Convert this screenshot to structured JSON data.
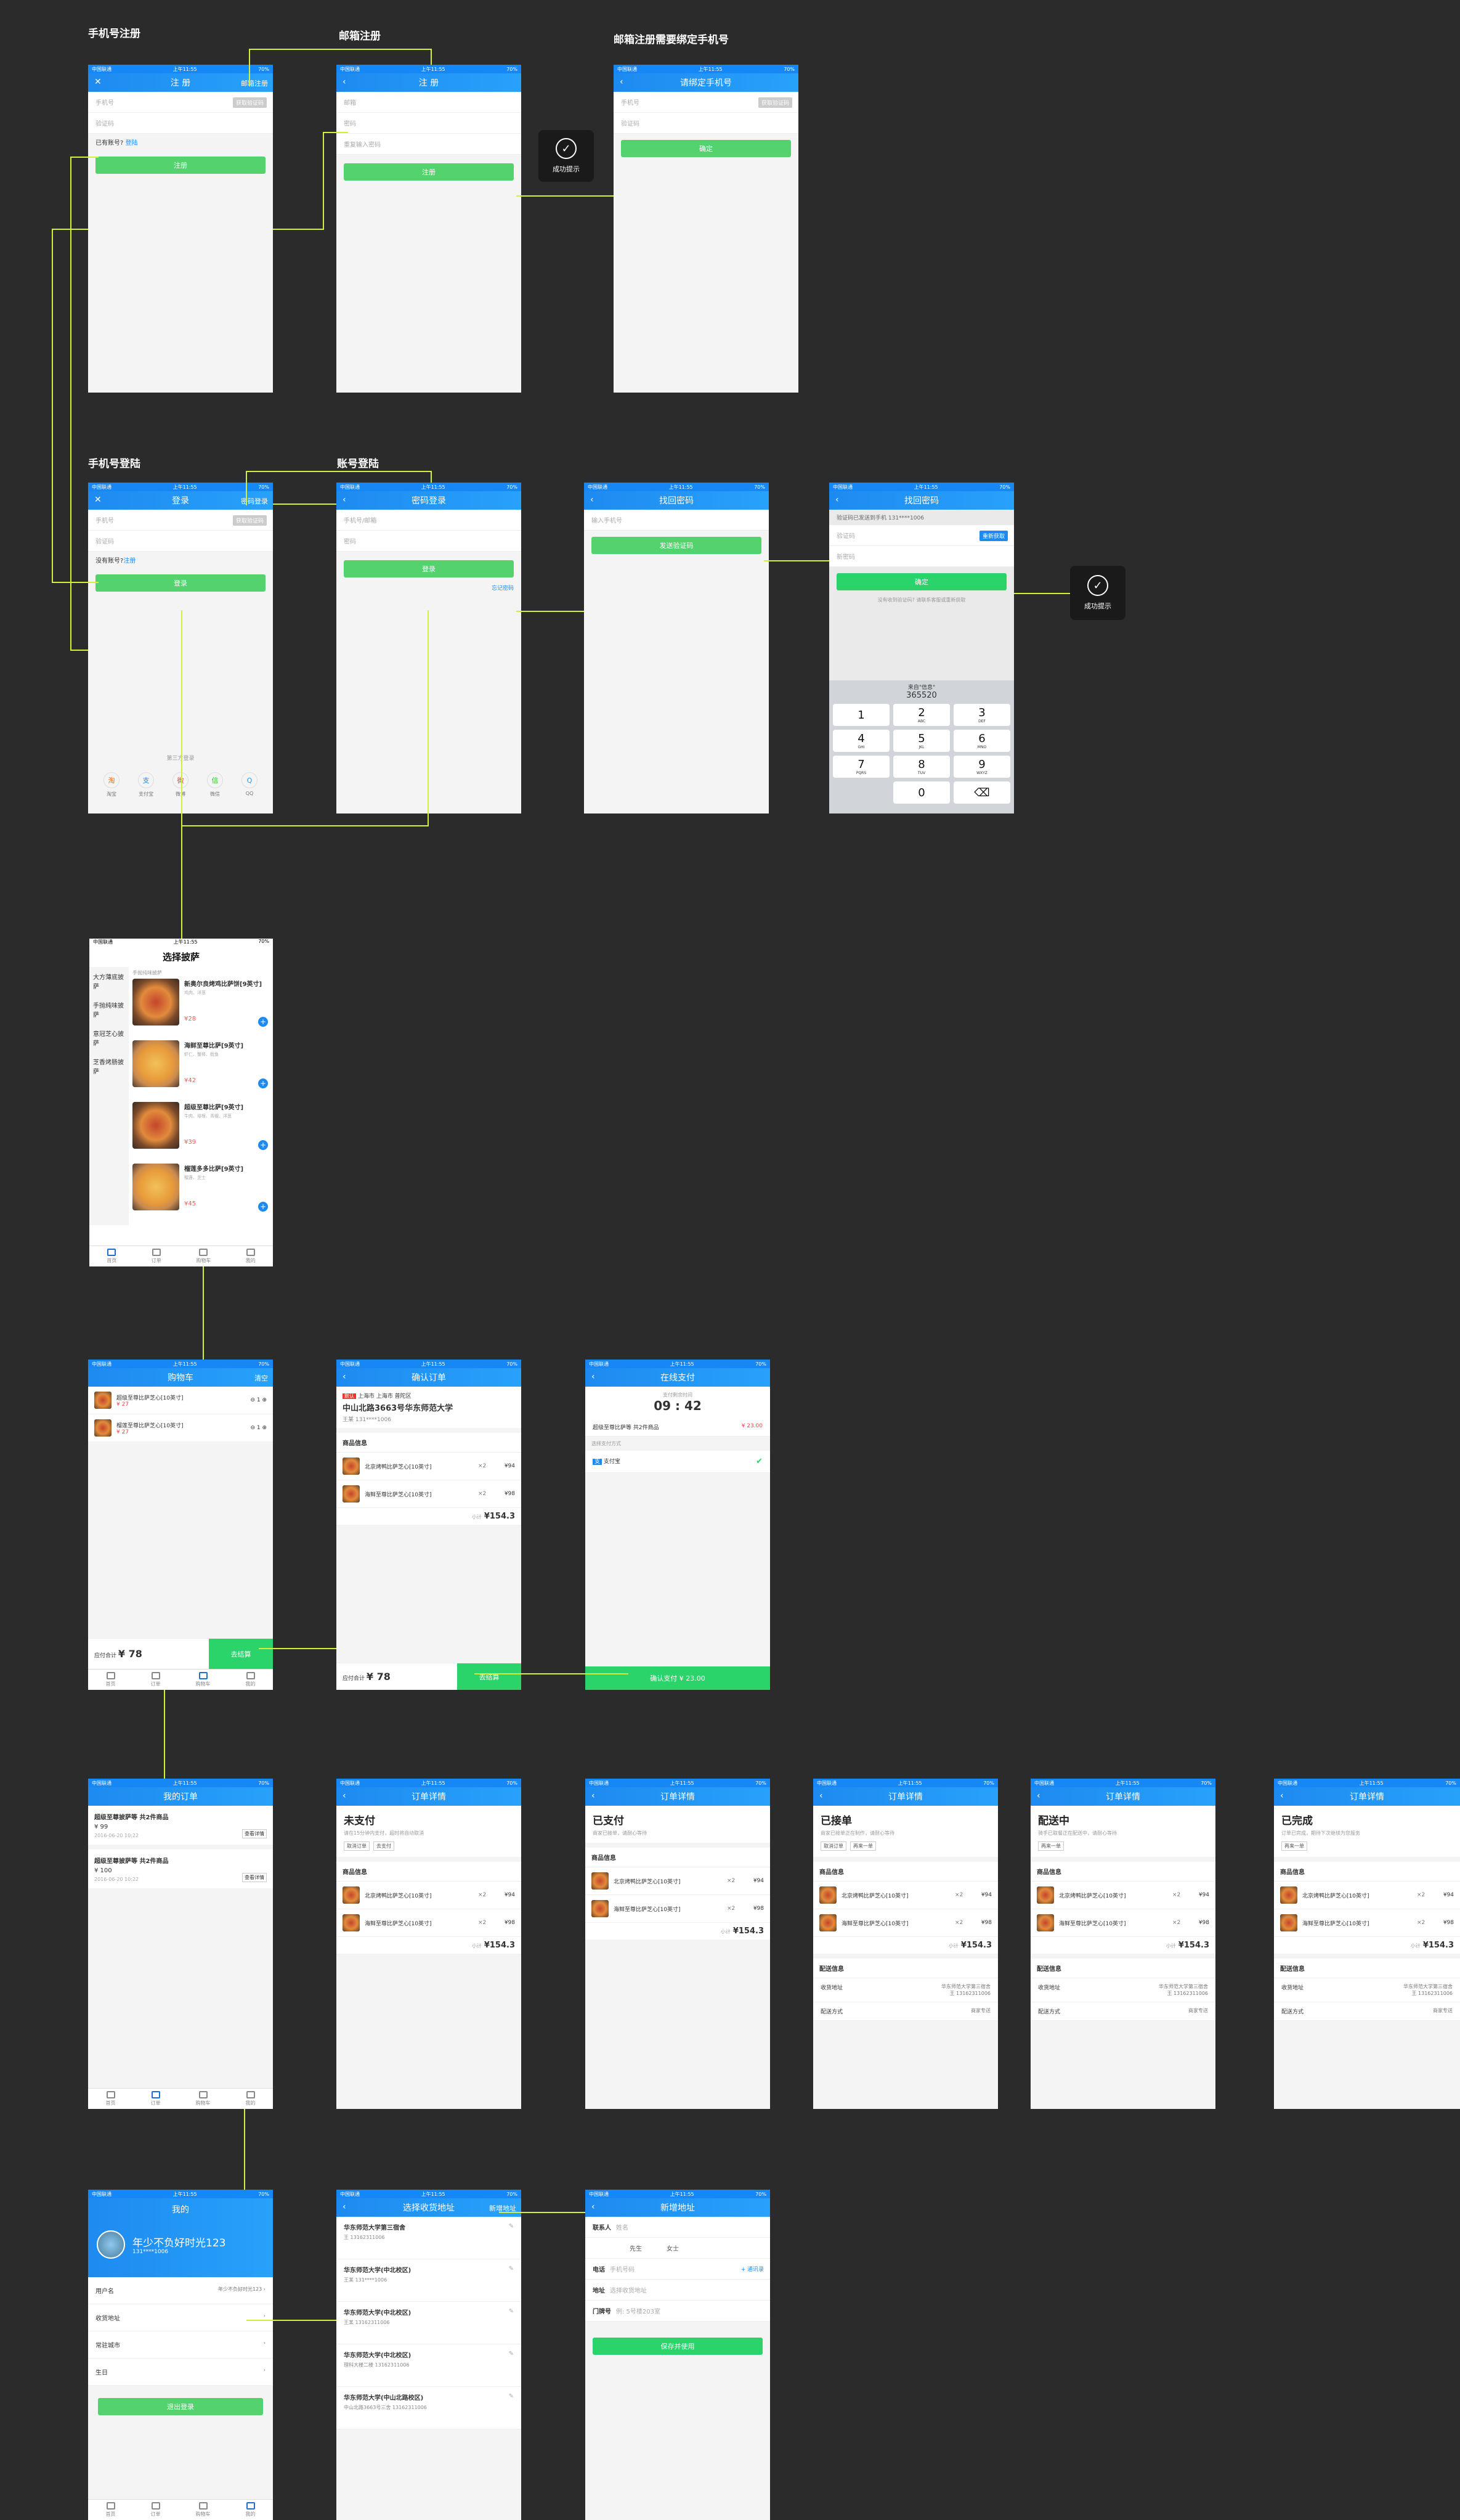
{
  "sections": {
    "phone_register": "手机号注册",
    "email_register": "邮箱注册",
    "email_bind": "邮箱注册需要绑定手机号",
    "phone_login": "手机号登陆",
    "account_login": "账号登陆"
  },
  "status": {
    "carrier": "中国联通",
    "time": "上午11:55",
    "battery": "70%"
  },
  "toast": {
    "success": "成功提示"
  },
  "register": {
    "title": "注 册",
    "right": "邮箱注册",
    "phone_ph": "手机号",
    "code_btn": "获取验证码",
    "code_ph": "验证码",
    "have_account": "已有账号?",
    "login_link": "登陆",
    "submit": "注册"
  },
  "email_reg": {
    "title": "注 册",
    "email_ph": "邮箱",
    "pwd_ph": "密码",
    "pwd2_ph": "重复输入密码",
    "submit": "注册"
  },
  "bind": {
    "title": "请绑定手机号",
    "phone_ph": "手机号",
    "code_btn": "获取验证码",
    "code_ph": "验证码",
    "submit": "确定"
  },
  "login": {
    "title": "登录",
    "right": "密码登录",
    "phone_ph": "手机号",
    "code_btn": "获取验证码",
    "code_ph": "验证码",
    "no_account": "没有账号?",
    "reg_link": "注册",
    "submit": "登录",
    "third": "第三方登录",
    "socials": [
      "淘宝",
      "支付宝",
      "微博",
      "微信",
      "QQ"
    ]
  },
  "pwd_login": {
    "title": "密码登录",
    "account_ph": "手机号/邮箱",
    "pwd_ph": "密码",
    "submit": "登录",
    "forgot": "忘记密码"
  },
  "find1": {
    "title": "找回密码",
    "phone_ph": "输入手机号",
    "submit": "发送验证码"
  },
  "find2": {
    "title": "找回密码",
    "sent": "验证码已发送到手机 131****1006",
    "code_ph": "验证码",
    "resend": "重新获取",
    "newpwd_ph": "新密码",
    "submit": "确定",
    "hint": "没有收到验证码? 请联系客服或重新获取",
    "sms_from": "来自\"信息\"",
    "sms_code": "365520",
    "keys": [
      {
        "n": "1",
        "s": ""
      },
      {
        "n": "2",
        "s": "ABC"
      },
      {
        "n": "3",
        "s": "DEF"
      },
      {
        "n": "4",
        "s": "GHI"
      },
      {
        "n": "5",
        "s": "JKL"
      },
      {
        "n": "6",
        "s": "MNO"
      },
      {
        "n": "7",
        "s": "PQRS"
      },
      {
        "n": "8",
        "s": "TUV"
      },
      {
        "n": "9",
        "s": "WXYZ"
      },
      {
        "n": "",
        "s": ""
      },
      {
        "n": "0",
        "s": ""
      },
      {
        "n": "⌫",
        "s": ""
      }
    ]
  },
  "menu": {
    "title": "选择披萨",
    "cats": [
      "大方薄底披萨",
      "手抛纯味披萨",
      "意冠芝心披萨",
      "芝香烤肠披萨"
    ],
    "cat_header": "手抛纯味披萨",
    "items": [
      {
        "name": "新奥尔良烤鸡比萨饼[9英寸]",
        "desc": "鸡肉、洋葱",
        "price": "¥28"
      },
      {
        "name": "海鲜至尊比萨[9英寸]",
        "desc": "虾仁、蟹棒、鱿鱼",
        "price": "¥42"
      },
      {
        "name": "超级至尊比萨[9英寸]",
        "desc": "牛肉、培根、青椒、洋葱",
        "price": "¥39"
      },
      {
        "name": "榴莲多多比萨[9英寸]",
        "desc": "榴莲、芝士",
        "price": "¥45"
      }
    ],
    "tabs": [
      "首页",
      "订单",
      "购物车",
      "我的"
    ]
  },
  "cart": {
    "title": "购物车",
    "right": "清空",
    "items": [
      {
        "name": "超级至尊比萨芝心[10英寸]",
        "price": "¥ 27"
      },
      {
        "name": "榴莲至尊比萨芝心[10英寸]",
        "price": "¥ 27"
      }
    ],
    "total_label": "应付合计",
    "total": "¥ 78",
    "checkout": "去结算"
  },
  "confirm": {
    "title": "确认订单",
    "tag": "默认",
    "city": "上海市 上海市 普陀区",
    "addr": "中山北路3663号华东师范大学",
    "person": "王某 131****1006",
    "goods_title": "商品信息",
    "items": [
      {
        "name": "北京烤鸭比萨芝心[10英寸]",
        "qty": "×2",
        "price": "¥94"
      },
      {
        "name": "海鲜至尊比萨芝心[10英寸]",
        "qty": "×2",
        "price": "¥98"
      }
    ],
    "subtotal_label": "小计",
    "subtotal": "¥154.3",
    "total_label": "应付合计",
    "total": "¥ 78",
    "submit": "去结算"
  },
  "pay": {
    "title": "在线支付",
    "remain": "支付剩余时间",
    "time": "09 : 42",
    "goods": "超级至尊比萨等 共2件商品",
    "amount": "¥ 23.00",
    "method_label": "选择支付方式",
    "method": "支付宝",
    "submit": "确认支付 ¥ 23.00"
  },
  "orders": {
    "title": "我的订单",
    "items": [
      {
        "name": "超级至尊披萨等 共2件商品",
        "price": "¥ 99",
        "date": "2016-06-20 10:22",
        "btn": "查看详情"
      },
      {
        "name": "超级至尊披萨等 共2件商品",
        "price": "¥ 100",
        "date": "2016-06-20 10:22",
        "btn": "查看详情"
      }
    ],
    "tabs": [
      "首页",
      "订单",
      "购物车",
      "我的"
    ]
  },
  "details": [
    {
      "title": "订单详情",
      "status": "未支付",
      "desc": "请在15分钟内支付，超时将自动取消",
      "btns": [
        "取消订单",
        "去支付"
      ],
      "has_delivery": false
    },
    {
      "title": "订单详情",
      "status": "已支付",
      "desc": "商家已接单，请耐心等待",
      "btns": [],
      "has_delivery": false
    },
    {
      "title": "订单详情",
      "status": "已接单",
      "desc": "商家已接单正在制作，请耐心等待",
      "btns": [
        "取消订单",
        "再来一单"
      ],
      "has_delivery": true
    },
    {
      "title": "订单详情",
      "status": "配送中",
      "desc": "骑手已取餐正在配送中，请耐心等待",
      "btns": [
        "再来一单"
      ],
      "has_delivery": true
    },
    {
      "title": "订单详情",
      "status": "已完成",
      "desc": "订单已完成，期待下次继续为您服务",
      "btns": [
        "再来一单"
      ],
      "has_delivery": true
    }
  ],
  "detail_common": {
    "goods_title": "商品信息",
    "items": [
      {
        "name": "北京烤鸭比萨芝心[10英寸]",
        "qty": "×2",
        "price": "¥94"
      },
      {
        "name": "海鲜至尊比萨芝心[10英寸]",
        "qty": "×2",
        "price": "¥98"
      }
    ],
    "subtotal_label": "小计",
    "subtotal": "¥154.3",
    "delivery_title": "配送信息",
    "addr_label": "收货地址",
    "addr_val": "华东师范大学第三宿舍",
    "addr_sub": "王 13162311006",
    "method_label": "配送方式",
    "method_val": "商家专送"
  },
  "mine": {
    "title": "我的",
    "nick": "年少不负好时光123",
    "phone": "131****1006",
    "rows": [
      {
        "label": "用户名",
        "value": "年少不负好时光123"
      },
      {
        "label": "收货地址",
        "value": ""
      },
      {
        "label": "常驻城市",
        "value": ""
      },
      {
        "label": "生日",
        "value": ""
      }
    ],
    "logout": "退出登录",
    "tabs": [
      "首页",
      "订单",
      "购物车",
      "我的"
    ]
  },
  "addr_list": {
    "title": "选择收货地址",
    "right": "新增地址",
    "items": [
      {
        "name": "华东师范大学第三宿舍",
        "sub": "王 13162311006"
      },
      {
        "name": "华东师范大学(中北校区)",
        "sub": "王某 131****1006"
      },
      {
        "name": "华东师范大学(中北校区)",
        "sub": "王某 13162311006"
      },
      {
        "name": "华东师范大学(中北校区)",
        "sub": "理科大楼二楼 13162311006"
      },
      {
        "name": "华东师范大学(中山北路校区)",
        "sub": "中山北路3663号三舍 13162311006"
      }
    ]
  },
  "new_addr": {
    "title": "新增地址",
    "contact": "联系人",
    "contact_ph": "姓名",
    "male": "先生",
    "female": "女士",
    "phone": "电话",
    "phone_ph": "手机号码",
    "contacts_link": "+ 通讯录",
    "addr": "地址",
    "addr_ph": "选择收货地址",
    "door": "门牌号",
    "door_ph": "例: 5号楼203室",
    "submit": "保存并使用"
  }
}
